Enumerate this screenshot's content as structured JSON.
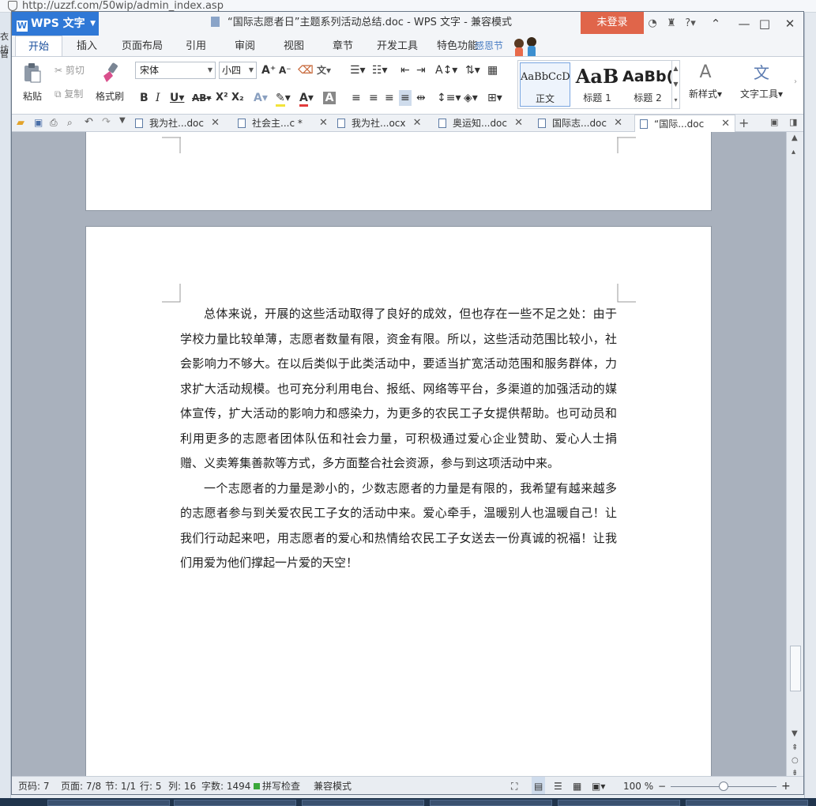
{
  "browser": {
    "url": "http://uzzf.com/50wip/admin_index.asp",
    "left_fragments": [
      "衣坊",
      "管"
    ]
  },
  "app": {
    "logo_label": "WPS 文字",
    "title": "“国际志愿者日”主题系列活动总结.doc - WPS 文字 - 兼容模式",
    "login_label": "未登录",
    "help_label": "?"
  },
  "ribbon_tabs": [
    {
      "label": "开始",
      "active": true
    },
    {
      "label": "插入"
    },
    {
      "label": "页面布局"
    },
    {
      "label": "引用"
    },
    {
      "label": "审阅"
    },
    {
      "label": "视图"
    },
    {
      "label": "章节"
    },
    {
      "label": "开发工具"
    },
    {
      "label": "特色功能"
    }
  ],
  "festival_label": "感恩节",
  "ribbon": {
    "paste": "粘贴",
    "cut": "剪切",
    "copy": "复制",
    "format_painter": "格式刷",
    "font_name": "宋体",
    "font_size": "小四",
    "new_style": "新样式",
    "text_tools": "文字工具",
    "styles": [
      {
        "preview": "AaBbCcD",
        "label": "正文",
        "selected": true
      },
      {
        "preview": "AaB",
        "label": "标题 1"
      },
      {
        "preview": "AaBb(",
        "label": "标题 2"
      }
    ]
  },
  "doc_tabs": [
    {
      "label": "我为社...doc"
    },
    {
      "label": "社会主...c *"
    },
    {
      "label": "我为社...ocx"
    },
    {
      "label": "奥运知...doc"
    },
    {
      "label": "国际志...doc"
    },
    {
      "label": "“国际...doc",
      "active": true
    }
  ],
  "document": {
    "paragraphs": [
      "总体来说，开展的这些活动取得了良好的成效，但也存在一些不足之处：由于学校力量比较单薄，志愿者数量有限，资金有限。所以，这些活动范围比较小，社会影响力不够大。在以后类似于此类活动中，要适当扩宽活动范围和服务群体，力求扩大活动规模。也可充分利用电台、报纸、网络等平台，多渠道的加强活动的媒体宣传，扩大活动的影响力和感染力，为更多的农民工子女提供帮助。也可动员和利用更多的志愿者团体队伍和社会力量，可积极通过爱心企业赞助、爱心人士捐赠、义卖筹集善款等方式，多方面整合社会资源，参与到这项活动中来。",
      "一个志愿者的力量是渺小的，少数志愿者的力量是有限的，我希望有越来越多的志愿者参与到关爱农民工子女的活动中来。爱心牵手，温暖别人也温暖自己！让我们行动起来吧，用志愿者的爱心和热情给农民工子女送去一份真诚的祝福！让我们用爱为他们撑起一片爱的天空！"
    ]
  },
  "status": {
    "page_number": "页码: 7",
    "page": "页面: 7/8",
    "section": "节: 1/1",
    "row": "行: 5",
    "col": "列: 16",
    "word_count": "字数: 1494",
    "spell_check": "拼写检查",
    "compat_mode": "兼容模式",
    "zoom": "100 %",
    "zoom_level": 100
  },
  "colors": {
    "wps_blue": "#2f78d6",
    "login_orange": "#e0654a",
    "spell_green": "#3aa83a"
  }
}
